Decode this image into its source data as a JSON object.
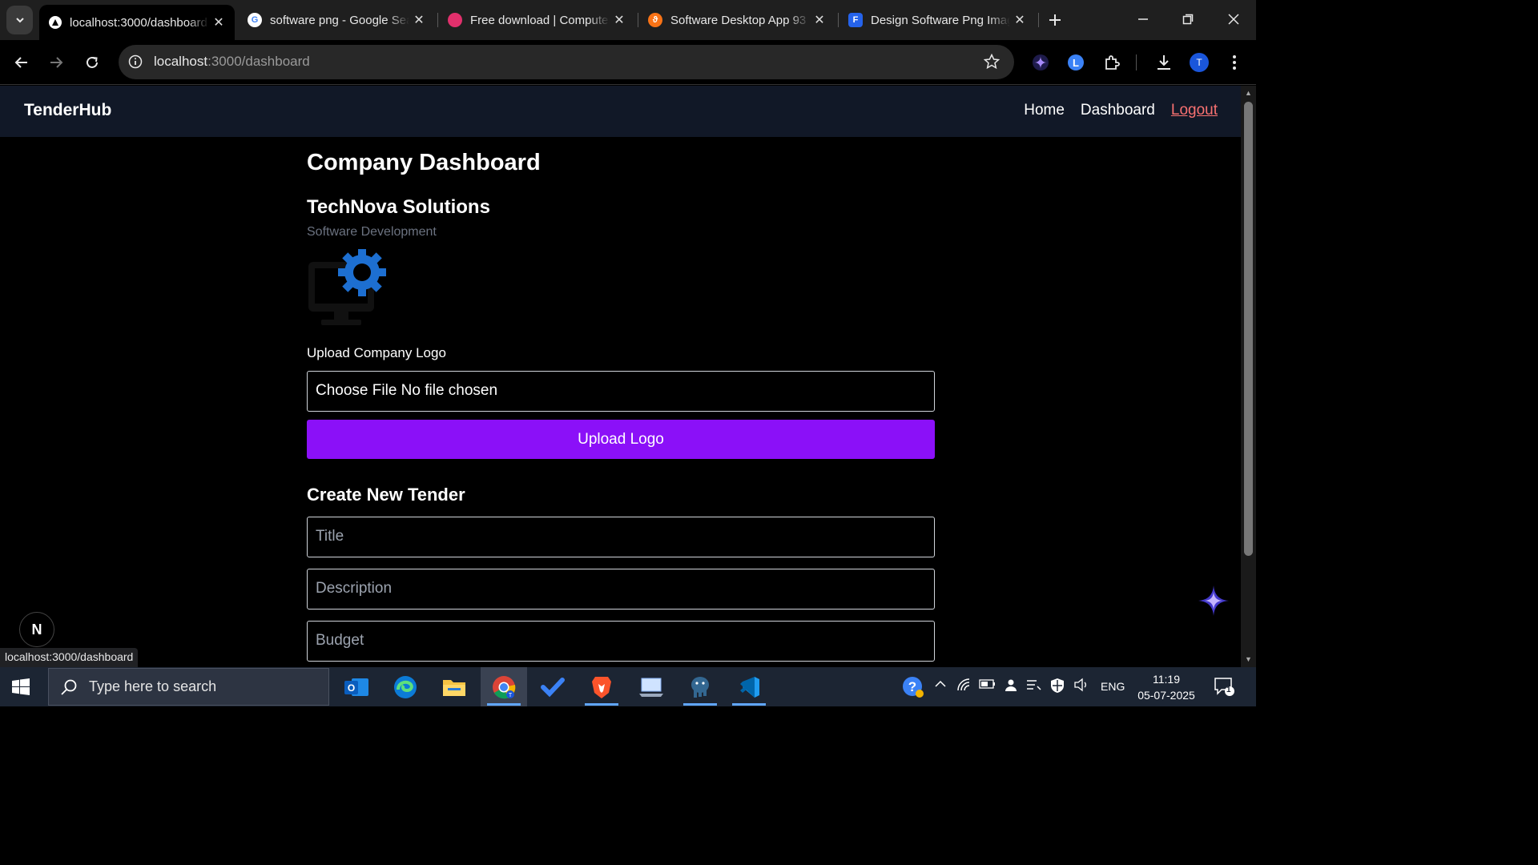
{
  "browser": {
    "tabs": [
      {
        "title": "localhost:3000/dashboard",
        "icon": "nextjs-triangle-icon",
        "active": true
      },
      {
        "title": "software png - Google Search",
        "icon": "google-g-icon",
        "active": false
      },
      {
        "title": "Free download | Computer software",
        "icon": "drop-icon",
        "active": false
      },
      {
        "title": "Software Desktop App 93",
        "icon": "orange-logo-icon",
        "active": false
      },
      {
        "title": "Design Software Png Images",
        "icon": "blue-doc-icon",
        "active": false
      }
    ],
    "address": {
      "host": "localhost",
      "path": ":3000/dashboard"
    },
    "status_url": "localhost:3000/dashboard",
    "profile_initial": "T"
  },
  "app": {
    "brand": "TenderHub",
    "nav": {
      "home": "Home",
      "dashboard": "Dashboard",
      "logout": "Logout"
    },
    "heading": "Company Dashboard",
    "company": {
      "name": "TechNova Solutions",
      "industry": "Software Development"
    },
    "upload": {
      "label": "Upload Company Logo",
      "file_input_text": "Choose File No file chosen",
      "button": "Upload Logo"
    },
    "tender_form": {
      "heading": "Create New Tender",
      "title_placeholder": "Title",
      "description_placeholder": "Description",
      "budget_placeholder": "Budget"
    },
    "nextjs_badge": "N"
  },
  "colors": {
    "navbar_bg": "#111827",
    "primary_button": "#8b10f8",
    "logout_link": "#f87171",
    "muted_text": "#6b7280"
  },
  "taskbar": {
    "search_placeholder": "Type here to search",
    "apps": [
      "outlook-icon",
      "edge-icon",
      "file-explorer-icon",
      "chrome-icon",
      "todo-icon",
      "brave-icon",
      "laptop-app-icon",
      "postgres-icon",
      "vscode-icon"
    ],
    "tray": {
      "language": "ENG",
      "time": "11:19",
      "date": "05-07-2025",
      "notifications": "1"
    }
  }
}
